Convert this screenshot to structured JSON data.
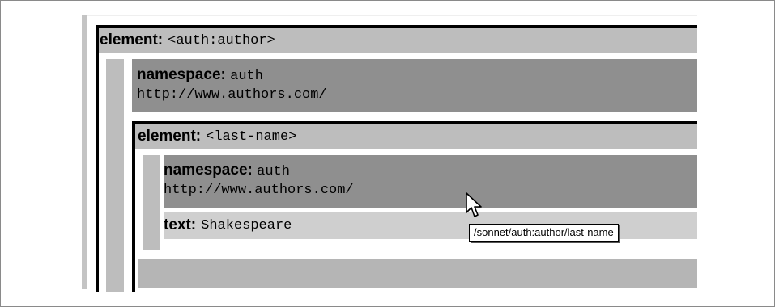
{
  "outer_element": {
    "keyword": "element:",
    "tag": "<auth:author>"
  },
  "outer_namespace": {
    "keyword": "namespace:",
    "prefix": "auth",
    "uri": "http://www.authors.com/"
  },
  "inner_element": {
    "keyword": "element:",
    "tag": "<last-name>"
  },
  "inner_namespace": {
    "keyword": "namespace:",
    "prefix": "auth",
    "uri": "http://www.authors.com/"
  },
  "text_node": {
    "keyword": "text:",
    "value": "Shakespeare"
  },
  "tooltip": {
    "text": "/sonnet/auth:author/last-name"
  },
  "cursor": {
    "icon": "arrow-cursor-icon"
  }
}
